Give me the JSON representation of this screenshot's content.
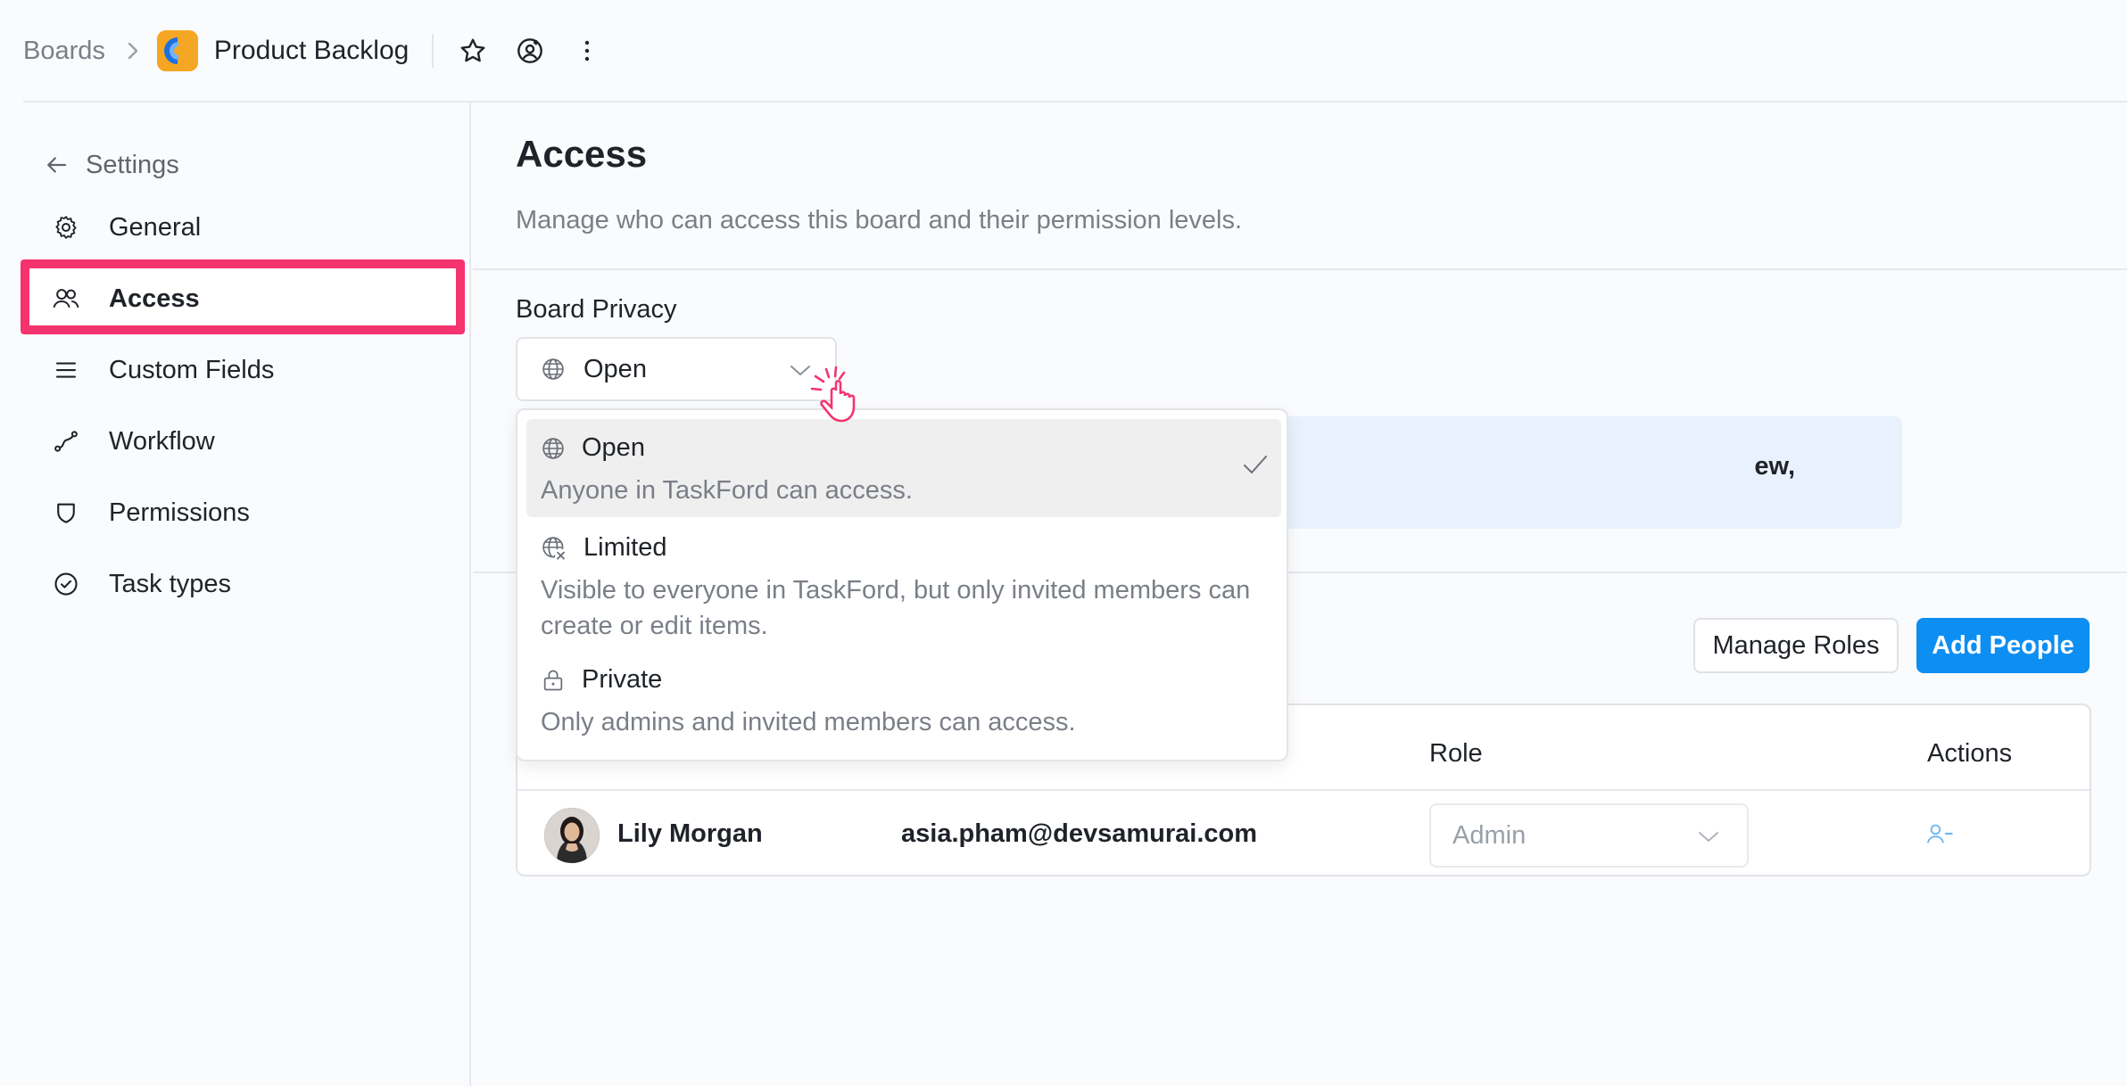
{
  "topbar": {
    "breadcrumb_root": "Boards",
    "board_title": "Product Backlog",
    "icons": [
      "chevron-right-icon",
      "star-icon",
      "watch-icon",
      "more-vertical-icon"
    ]
  },
  "sidebar": {
    "back_label": "Settings",
    "items": [
      {
        "label": "General",
        "icon": "gear-icon"
      },
      {
        "label": "Access",
        "icon": "users-icon"
      },
      {
        "label": "Custom Fields",
        "icon": "list-icon"
      },
      {
        "label": "Workflow",
        "icon": "workflow-icon"
      },
      {
        "label": "Permissions",
        "icon": "shield-icon"
      },
      {
        "label": "Task types",
        "icon": "check-circle-icon"
      }
    ],
    "active": "Access",
    "highlight_color": "#f4336f"
  },
  "main": {
    "title": "Access",
    "subtitle": "Manage who can access this board and their permission levels.",
    "privacy_label": "Board Privacy",
    "privacy_value": "Open",
    "info_fragment": "ew,",
    "manage_roles_label": "Manage Roles",
    "add_people_label": "Add People",
    "accent_color": "#0d8ef2"
  },
  "dropdown": {
    "options": [
      {
        "title": "Open",
        "desc": "Anyone in TaskFord can access.",
        "icon": "globe-icon",
        "selected": true
      },
      {
        "title": "Limited",
        "desc": "Visible to everyone in TaskFord, but only invited members can create or edit items.",
        "icon": "globe-limited-icon",
        "selected": false
      },
      {
        "title": "Private",
        "desc": "Only admins and invited members can access.",
        "icon": "lock-icon",
        "selected": false
      }
    ]
  },
  "table": {
    "columns": {
      "role": "Role",
      "actions": "Actions"
    },
    "rows": [
      {
        "name": "Lily Morgan",
        "email": "asia.pham@devsamurai.com",
        "role": "Admin"
      }
    ]
  }
}
